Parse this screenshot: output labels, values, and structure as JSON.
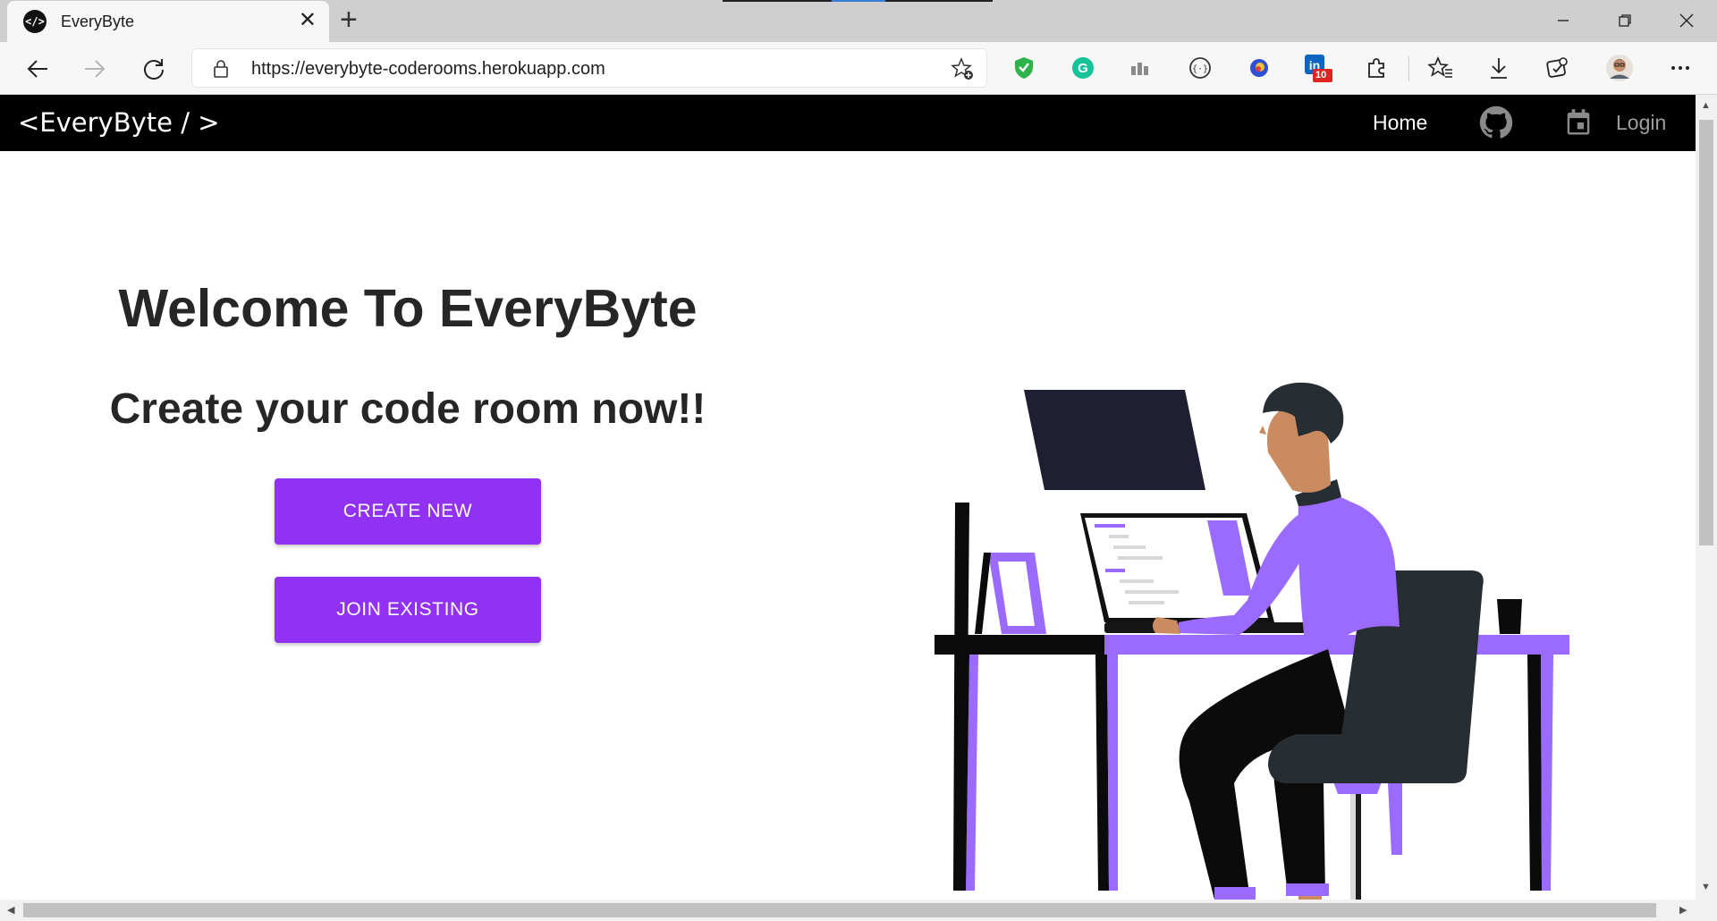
{
  "browser": {
    "tab_title": "EveryByte",
    "url": "https://everybyte-coderooms.herokuapp.com",
    "linkedin_badge": "10",
    "extension_icons": [
      "shield-icon",
      "grammarly-icon",
      "bars-icon",
      "code-brackets-icon",
      "colorful-circle-icon",
      "linkedin-icon",
      "puzzle-icon",
      "favorites-icon",
      "download-icon",
      "collections-icon",
      "avatar",
      "more-icon"
    ]
  },
  "navbar": {
    "brand": "<EveryByte / >",
    "home": "Home",
    "login": "Login"
  },
  "hero": {
    "title": "Welcome To EveryByte",
    "subtitle": "Create your code room now!!",
    "create_button": "CREATE NEW",
    "join_button": "JOIN EXISTING"
  },
  "colors": {
    "accent": "#9031f3",
    "navbar": "#000000",
    "illustration_purple": "#9b6bff",
    "illustration_dark": "#1f2937"
  }
}
